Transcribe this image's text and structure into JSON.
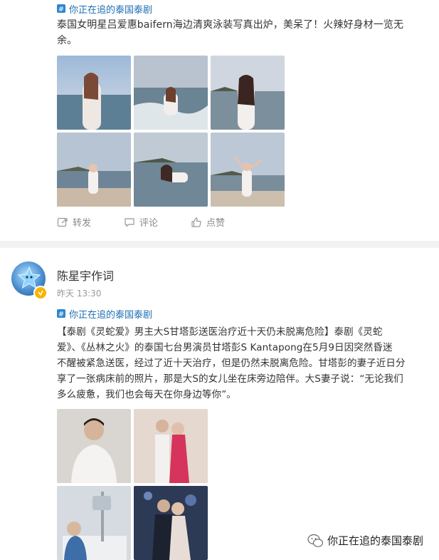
{
  "post1": {
    "topic_tag": "你正在追的泰国泰剧",
    "text_line1": "泰国女明星吕爱惠baifern海边清爽泳装写真出炉，美呆了！火辣好身材一览无",
    "text_line2": "余。",
    "actions": {
      "repost": "转发",
      "comment": "评论",
      "like": "点赞"
    }
  },
  "post2": {
    "author": "陈星宇作词",
    "timestamp": "昨天 13:30",
    "topic_tag": "你正在追的泰国泰剧",
    "text_lines": [
      "【泰剧《灵蛇爱》男主大S甘塔彭送医治疗近十天仍未脱离危险】泰剧《灵蛇",
      "爱》、《丛林之火》的泰国七台男演员甘塔彭S  Kantapong在5月9日因突然昏迷",
      "不醒被紧急送医，经过了近十天治疗，但是仍然未脱离危险。甘塔彭的妻子近日分",
      "享了一张病床前的照片，那是大S的女儿坐在床旁边陪伴。大S妻子说：“无论我们",
      "多么疲惫，我们也会每天在你身边等你”。"
    ]
  },
  "watermark": "你正在追的泰国泰剧",
  "colors": {
    "topic_blue": "#1f6fb2",
    "text": "#333333",
    "muted": "#999999",
    "divider": "#f2f2f2"
  }
}
